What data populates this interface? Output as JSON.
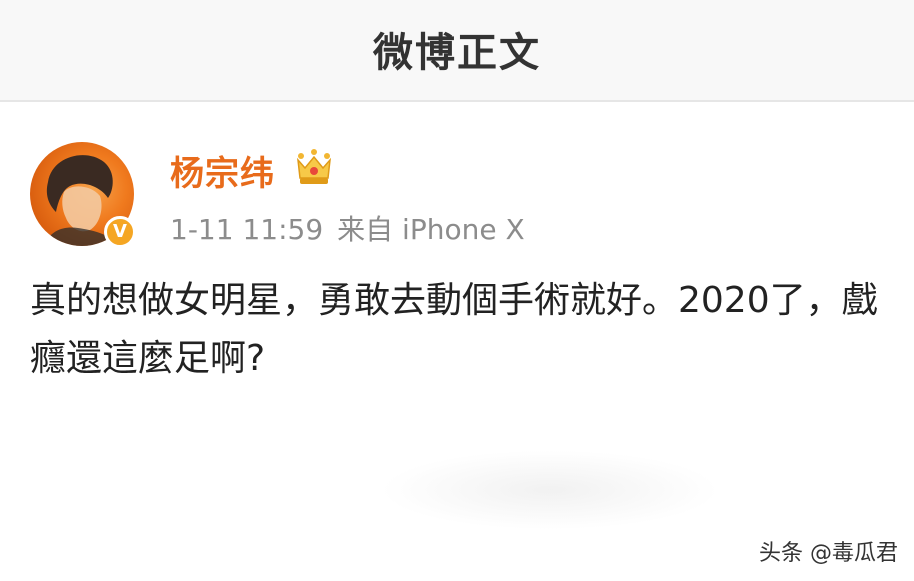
{
  "navbar": {
    "title": "微博正文"
  },
  "post": {
    "author": {
      "name": "杨宗纬",
      "avatar_icon": "avatar-photo",
      "verified_icon": "verified-badge-icon",
      "verified_glyph": "V",
      "vip_icon": "crown-icon"
    },
    "meta": {
      "time": "1-11 11:59",
      "source": "来自 iPhone X"
    },
    "body": "真的想做女明星，勇敢去動個手術就好。2020了，戲癮還這麼足啊?"
  },
  "watermark": {
    "text": "头条 @毒瓜君"
  },
  "colors": {
    "username": "#e86b1b",
    "navbar_bg": "#f8f8f8",
    "meta": "#8c8c8c",
    "badge": "#f5a623"
  }
}
